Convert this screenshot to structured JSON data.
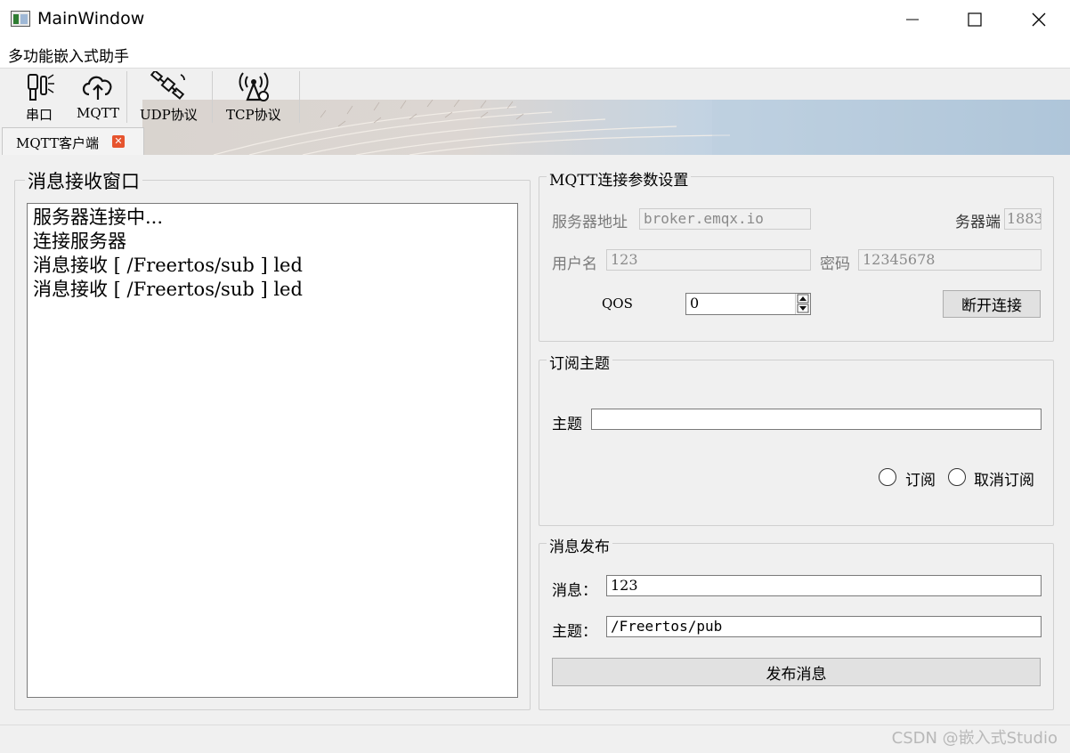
{
  "window": {
    "title": "MainWindow",
    "controls": {
      "minimize": "minimize-icon",
      "maximize": "maximize-icon",
      "close": "close-icon"
    }
  },
  "menubar": {
    "title": "多功能嵌入式助手"
  },
  "toolbar": {
    "items": [
      {
        "label": "串口",
        "icon": "usb-serial-icon"
      },
      {
        "label": "MQTT",
        "icon": "cloud-upload-icon"
      },
      {
        "label": "UDP协议",
        "icon": "satellite-icon"
      },
      {
        "label": "TCP协议",
        "icon": "wireless-tower-icon"
      }
    ]
  },
  "tabs": [
    {
      "label": "MQTT客户端",
      "close_icon": "close-icon"
    }
  ],
  "receive": {
    "title": "消息接收窗口",
    "lines": [
      "服务器连接中...",
      "连接服务器",
      "消息接收 [ /Freertos/sub ] led",
      "消息接收 [ /Freertos/sub ] led"
    ]
  },
  "connection": {
    "title": "MQTT连接参数设置",
    "server_label": "服务器地址",
    "server_value": "broker.emqx.io",
    "port_label": "务器端",
    "port_value": "1883",
    "user_label": "用户名",
    "user_value": "123",
    "password_label": "密码",
    "password_value": "12345678",
    "qos_label": "QOS",
    "qos_value": "0",
    "disconnect_label": "断开连接"
  },
  "subscribe": {
    "title": "订阅主题",
    "topic_label": "主题",
    "topic_value": "",
    "subscribe_label": "订阅",
    "unsubscribe_label": "取消订阅"
  },
  "publish": {
    "title": "消息发布",
    "message_label": "消息：",
    "message_value": "123",
    "topic_label": "主题：",
    "topic_value": "/Freertos/pub",
    "publish_label": "发布消息"
  },
  "status": {
    "watermark": "CSDN @嵌入式Studio"
  },
  "colors": {
    "tab_close": "#e6542e",
    "banner_sky": "#c9d8e6",
    "banner_grass": "#d8cfc6"
  }
}
